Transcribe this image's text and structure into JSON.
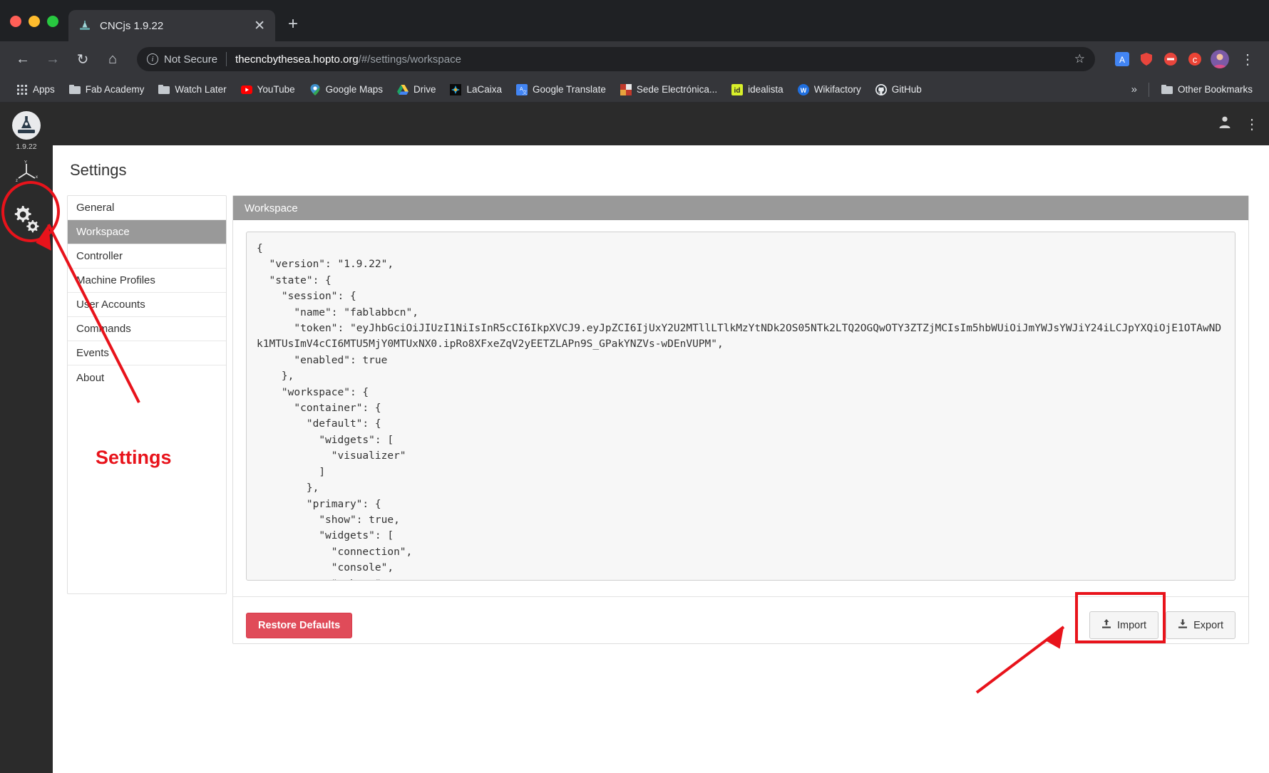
{
  "browser": {
    "tab": {
      "title": "CNCjs 1.9.22",
      "favicon": "cnc-logo-icon",
      "close": "✕"
    },
    "newtab_label": "+",
    "nav": {
      "back": "←",
      "forward": "→",
      "reload": "↻",
      "home": "⌂"
    },
    "omnibox": {
      "security_label": "Not Secure",
      "info_glyph": "i",
      "url_host": "thecncbythesea.hopto.org",
      "url_path": "/#/settings/workspace",
      "star": "☆"
    },
    "extensions": [
      "translate-ext-icon",
      "shield-ext-icon",
      "adblock-ext-icon",
      "c-ext-icon",
      "profile-avatar"
    ],
    "menu_glyph": "⋮",
    "bookmarks": [
      {
        "label": "Apps",
        "icon": "apps-grid-icon"
      },
      {
        "label": "Fab Academy",
        "icon": "folder-icon"
      },
      {
        "label": "Watch Later",
        "icon": "folder-icon"
      },
      {
        "label": "YouTube",
        "icon": "youtube-icon"
      },
      {
        "label": "Google Maps",
        "icon": "maps-pin-icon"
      },
      {
        "label": "Drive",
        "icon": "drive-icon"
      },
      {
        "label": "LaCaixa",
        "icon": "lacaixa-icon"
      },
      {
        "label": "Google Translate",
        "icon": "translate-icon"
      },
      {
        "label": "Sede Electrónica...",
        "icon": "sede-icon"
      },
      {
        "label": "idealista",
        "icon": "idealista-icon"
      },
      {
        "label": "Wikifactory",
        "icon": "wikifactory-icon"
      },
      {
        "label": "GitHub",
        "icon": "github-icon"
      }
    ],
    "bookmarks_overflow": "»",
    "other_bookmarks": {
      "label": "Other Bookmarks",
      "icon": "folder-icon"
    }
  },
  "app": {
    "brand": {
      "version": "1.9.22",
      "logo": "cnc-logo-icon"
    },
    "sidebar_items": [
      {
        "name": "workspace",
        "icon": "axes-xyz-icon",
        "active": false
      },
      {
        "name": "settings",
        "icon": "gears-icon",
        "active": true
      }
    ],
    "navbar_right": [
      {
        "name": "account",
        "icon": "user-icon"
      },
      {
        "name": "overflow",
        "icon": "kebab-icon",
        "glyph": "⋮"
      }
    ],
    "page_title": "Settings",
    "settings_menu": [
      {
        "label": "General",
        "active": false
      },
      {
        "label": "Workspace",
        "active": true
      },
      {
        "label": "Controller",
        "active": false
      },
      {
        "label": "Machine Profiles",
        "active": false
      },
      {
        "label": "User Accounts",
        "active": false
      },
      {
        "label": "Commands",
        "active": false
      },
      {
        "label": "Events",
        "active": false
      },
      {
        "label": "About",
        "active": false
      }
    ],
    "tabpanel_title": "Workspace",
    "config_json": "{\n  \"version\": \"1.9.22\",\n  \"state\": {\n    \"session\": {\n      \"name\": \"fablabbcn\",\n      \"token\": \"eyJhbGciOiJIUzI1NiIsInR5cCI6IkpXVCJ9.eyJpZCI6IjUxY2U2MTllLTlkMzYtNDk2OS05NTk2LTQ2OGQwOTY3ZTZjMCIsIm5hbWUiOiJmYWJsYWJiY24iLCJpYXQiOjE1OTAwNDk1MTUsImV4cCI6MTU5MjY0MTUxNX0.ipRo8XFxeZqV2yEETZLAPn9S_GPakYNZVs-wDEnVUPM\",\n      \"enabled\": true\n    },\n    \"workspace\": {\n      \"container\": {\n        \"default\": {\n          \"widgets\": [\n            \"visualizer\"\n          ]\n        },\n        \"primary\": {\n          \"show\": true,\n          \"widgets\": [\n            \"connection\",\n            \"console\",\n            \"webcam\"",
    "buttons": {
      "restore_defaults": "Restore Defaults",
      "import": "Import",
      "export": "Export",
      "import_icon": "upload-icon",
      "export_icon": "download-icon"
    }
  },
  "annotations": {
    "settings_label": "Settings",
    "color": "#e8131b"
  }
}
